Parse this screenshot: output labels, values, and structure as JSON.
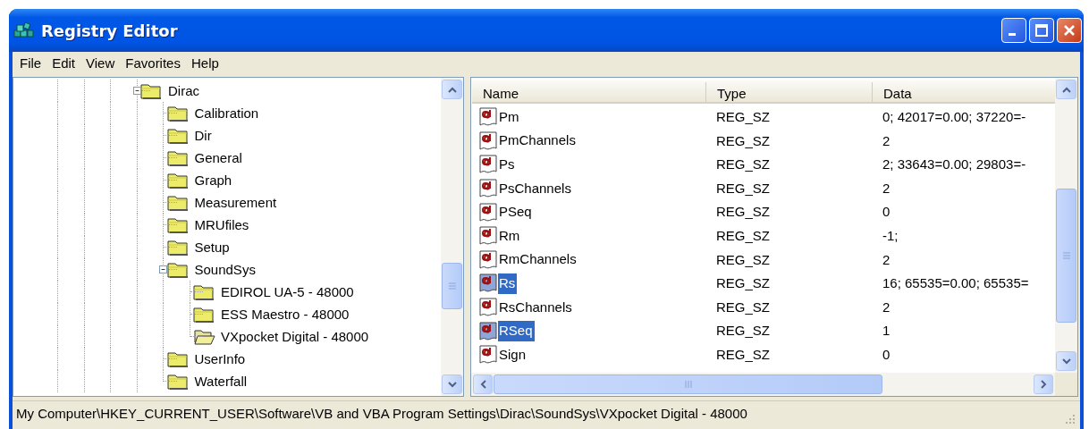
{
  "window": {
    "title": "Registry Editor"
  },
  "menu": [
    {
      "label": "File"
    },
    {
      "label": "Edit"
    },
    {
      "label": "View"
    },
    {
      "label": "Favorites"
    },
    {
      "label": "Help"
    }
  ],
  "tree": [
    {
      "label": "Dirac",
      "selected": false,
      "expanded": true,
      "children": [
        {
          "label": "Calibration",
          "selected": false
        },
        {
          "label": "Dir",
          "selected": false
        },
        {
          "label": "General",
          "selected": false
        },
        {
          "label": "Graph",
          "selected": false
        },
        {
          "label": "Measurement",
          "selected": false
        },
        {
          "label": "MRUfiles",
          "selected": false
        },
        {
          "label": "Setup",
          "selected": false
        },
        {
          "label": "SoundSys",
          "selected": false,
          "expanded": true,
          "children": [
            {
              "label": "EDIROL UA-5 - 48000",
              "selected": false
            },
            {
              "label": "ESS Maestro - 48000",
              "selected": false
            },
            {
              "label": "VXpocket Digital - 48000",
              "selected": true
            }
          ]
        },
        {
          "label": "UserInfo",
          "selected": false
        },
        {
          "label": "Waterfall",
          "selected": false
        }
      ]
    }
  ],
  "table": {
    "columns": [
      "Name",
      "Type",
      "Data"
    ],
    "rows": [
      {
        "name": "Pm",
        "type": "REG_SZ",
        "data": "0; 42017=0.00; 37220=-",
        "selected": false
      },
      {
        "name": "PmChannels",
        "type": "REG_SZ",
        "data": "2",
        "selected": false
      },
      {
        "name": "Ps",
        "type": "REG_SZ",
        "data": "2; 33643=0.00; 29803=-",
        "selected": false
      },
      {
        "name": "PsChannels",
        "type": "REG_SZ",
        "data": "2",
        "selected": false
      },
      {
        "name": "PSeq",
        "type": "REG_SZ",
        "data": "0",
        "selected": false
      },
      {
        "name": "Rm",
        "type": "REG_SZ",
        "data": "-1;",
        "selected": false
      },
      {
        "name": "RmChannels",
        "type": "REG_SZ",
        "data": "2",
        "selected": false
      },
      {
        "name": "Rs",
        "type": "REG_SZ",
        "data": "16; 65535=0.00; 65535=",
        "selected": true
      },
      {
        "name": "RsChannels",
        "type": "REG_SZ",
        "data": "2",
        "selected": false
      },
      {
        "name": "RSeq",
        "type": "REG_SZ",
        "data": "1",
        "selected": true
      },
      {
        "name": "Sign",
        "type": "REG_SZ",
        "data": "0",
        "selected": false
      }
    ]
  },
  "status_bar": "My Computer\\HKEY_CURRENT_USER\\Software\\VB and VBA Program Settings\\Dirac\\SoundSys\\VXpocket Digital - 48000"
}
